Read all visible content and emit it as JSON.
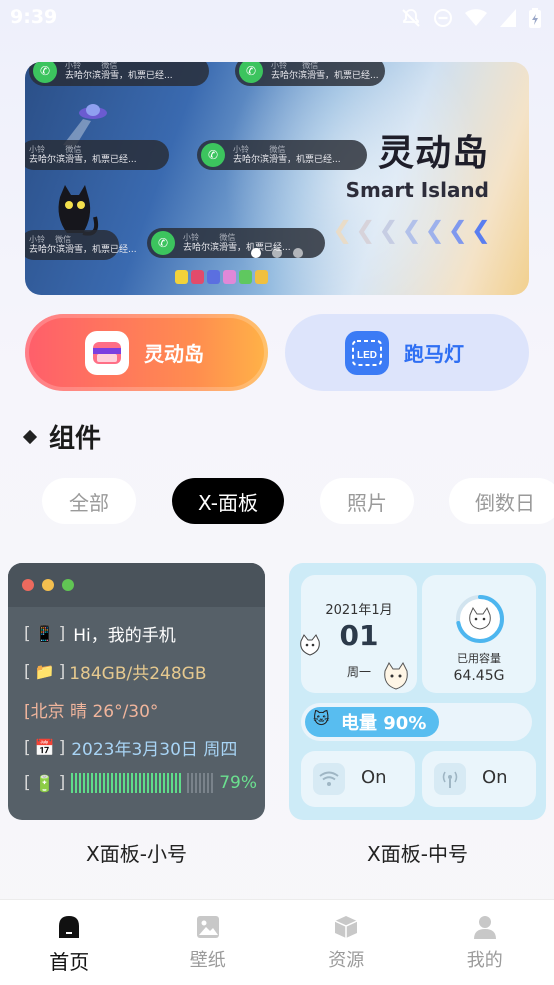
{
  "status_bar": {
    "time": "9:39"
  },
  "banner": {
    "title": "灵动岛",
    "subtitle": "Smart Island",
    "pills": [
      {
        "name": "小铃",
        "app": "微信",
        "text": "去哈尔滨滑雪，机票已经..."
      },
      {
        "name": "小铃",
        "app": "微信",
        "text": "去哈尔滨滑雪，机票已经..."
      },
      {
        "name": "小铃",
        "app": "微信",
        "text": "去哈尔滨滑雪，机票已经..."
      },
      {
        "name": "小铃",
        "app": "微信",
        "text": "去哈尔滨滑雪，机票已经..."
      },
      {
        "name": "小铃",
        "app": "微信",
        "text": "去哈尔滨滑雪，机票已经..."
      },
      {
        "name": "小铃",
        "app": "微信",
        "text": "去哈尔滨滑雪，机票已经..."
      }
    ],
    "page_count": 3,
    "active_page": 0
  },
  "features": [
    {
      "label": "灵动岛",
      "icon": "dynamic-island-icon"
    },
    {
      "label": "跑马灯",
      "icon": "led-icon"
    }
  ],
  "section": {
    "title": "组件"
  },
  "filters": {
    "items": [
      "全部",
      "X-面板",
      "照片",
      "倒数日"
    ],
    "active": "X-面板"
  },
  "widgets": {
    "small": {
      "caption": "X面板-小号",
      "rows": [
        {
          "icon": "phone-icon",
          "text": "Hi，我的手机",
          "color": "#ffffff"
        },
        {
          "icon": "folder-icon",
          "text": "184GB/共248GB",
          "color": "#e6c98f"
        },
        {
          "icon": "",
          "text": "[北京 晴 26°/30°",
          "color": "#f0b59c"
        },
        {
          "icon": "calendar-icon",
          "text": "2023年3月30日 周四",
          "color": "#a8d4f5"
        },
        {
          "icon": "battery-icon",
          "text": "79%",
          "color": "#6be08f"
        }
      ],
      "battery_level": 0.79
    },
    "medium": {
      "caption": "X面板-中号",
      "date_top": "2021年1月",
      "day": "01",
      "weekday": "周一",
      "capacity_label": "已用容量",
      "capacity_value": "64.45G",
      "capacity_fraction": 0.72,
      "power_label": "电量 90%",
      "power_fraction": 0.6,
      "wifi_state": "On",
      "signal_state": "On"
    }
  },
  "bottom_nav": {
    "items": [
      {
        "label": "首页",
        "icon": "home-icon"
      },
      {
        "label": "壁纸",
        "icon": "wallpaper-icon"
      },
      {
        "label": "资源",
        "icon": "resource-box-icon"
      },
      {
        "label": "我的",
        "icon": "profile-icon"
      }
    ],
    "active": "首页"
  },
  "colors": {
    "accent_red": "#ff5e6b",
    "accent_blue": "#2f6ff3",
    "dark_panel": "#566068",
    "light_panel": "#cdebf7"
  }
}
